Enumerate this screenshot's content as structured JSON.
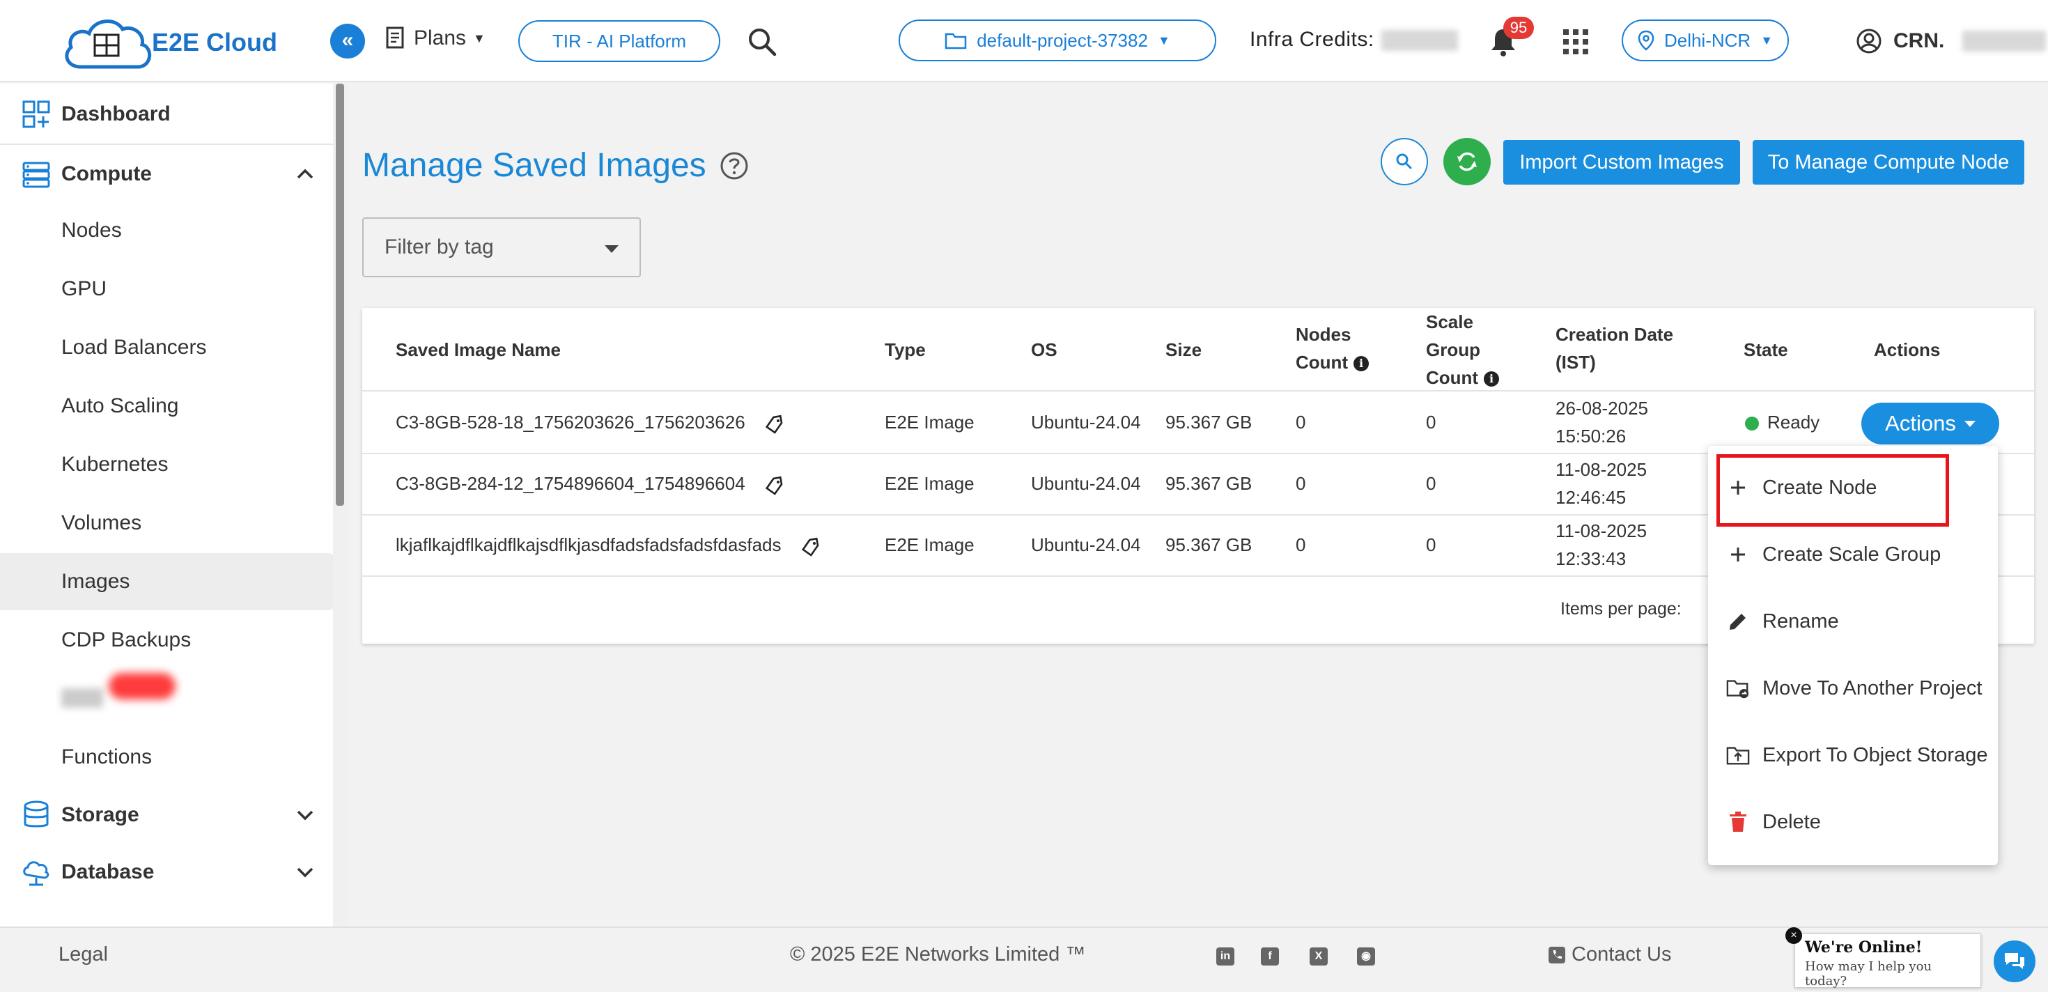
{
  "header": {
    "brand": "E2E Cloud",
    "plans_label": "Plans",
    "tir_label": "TIR - AI Platform",
    "project_label": "default-project-37382",
    "infra_label": "Infra Credits:",
    "notifications_count": "95",
    "region_label": "Delhi-NCR",
    "crn_label": "CRN."
  },
  "sidebar": {
    "items": [
      {
        "label": "Dashboard"
      },
      {
        "label": "Compute"
      },
      {
        "label": "Nodes"
      },
      {
        "label": "GPU"
      },
      {
        "label": "Load Balancers"
      },
      {
        "label": "Auto Scaling"
      },
      {
        "label": "Kubernetes"
      },
      {
        "label": "Volumes"
      },
      {
        "label": "Images"
      },
      {
        "label": "CDP Backups"
      },
      {
        "label": "Functions"
      },
      {
        "label": "Storage"
      },
      {
        "label": "Database"
      }
    ],
    "active_item": "Images"
  },
  "main": {
    "title": "Manage Saved Images",
    "import_button": "Import Custom Images",
    "manage_button": "To Manage Compute Node",
    "filter_placeholder": "Filter by tag"
  },
  "table": {
    "headers": {
      "name": "Saved Image Name",
      "type": "Type",
      "os": "OS",
      "size": "Size",
      "nodes_count": "Nodes Count",
      "scale_group_count": "Scale Group Count",
      "creation_date": "Creation Date (IST)",
      "state": "State",
      "actions": "Actions"
    },
    "rows": [
      {
        "name": "C3-8GB-528-18_1756203626_1756203626",
        "type": "E2E Image",
        "os": "Ubuntu-24.04",
        "size": "95.367 GB",
        "nodes": "0",
        "scale": "0",
        "date": "26-08-2025",
        "time": "15:50:26",
        "state": "Ready"
      },
      {
        "name": "C3-8GB-284-12_1754896604_1754896604",
        "type": "E2E Image",
        "os": "Ubuntu-24.04",
        "size": "95.367 GB",
        "nodes": "0",
        "scale": "0",
        "date": "11-08-2025",
        "time": "12:46:45"
      },
      {
        "name": "lkjaflkajdflkajdflkajsdflkjasdfadsfadsfadsfdasfads",
        "type": "E2E Image",
        "os": "Ubuntu-24.04",
        "size": "95.367 GB",
        "nodes": "0",
        "scale": "0",
        "date": "11-08-2025",
        "time": "12:33:43"
      }
    ],
    "actions_button": "Actions",
    "items_per_page_label": "Items per page:"
  },
  "actions_menu": {
    "items": [
      {
        "label": "Create Node",
        "icon": "plus-icon"
      },
      {
        "label": "Create Scale Group",
        "icon": "plus-icon"
      },
      {
        "label": "Rename",
        "icon": "pencil-icon"
      },
      {
        "label": "Move To Another Project",
        "icon": "folder-move-icon"
      },
      {
        "label": "Export To Object Storage",
        "icon": "folder-upload-icon"
      },
      {
        "label": "Delete",
        "icon": "trash-icon"
      }
    ],
    "highlighted": "Create Node"
  },
  "footer": {
    "legal": "Legal",
    "copyright": "© 2025 E2E Networks Limited ™",
    "contact": "Contact Us",
    "chat_title": "We're Online!",
    "chat_subtitle": "How may I help you today?"
  },
  "colors": {
    "primary": "#1a8fe0",
    "title_blue": "#1a88d6",
    "ready_green": "#2eae4c",
    "delete_red": "#e53935",
    "highlight_red": "#e8141c"
  }
}
